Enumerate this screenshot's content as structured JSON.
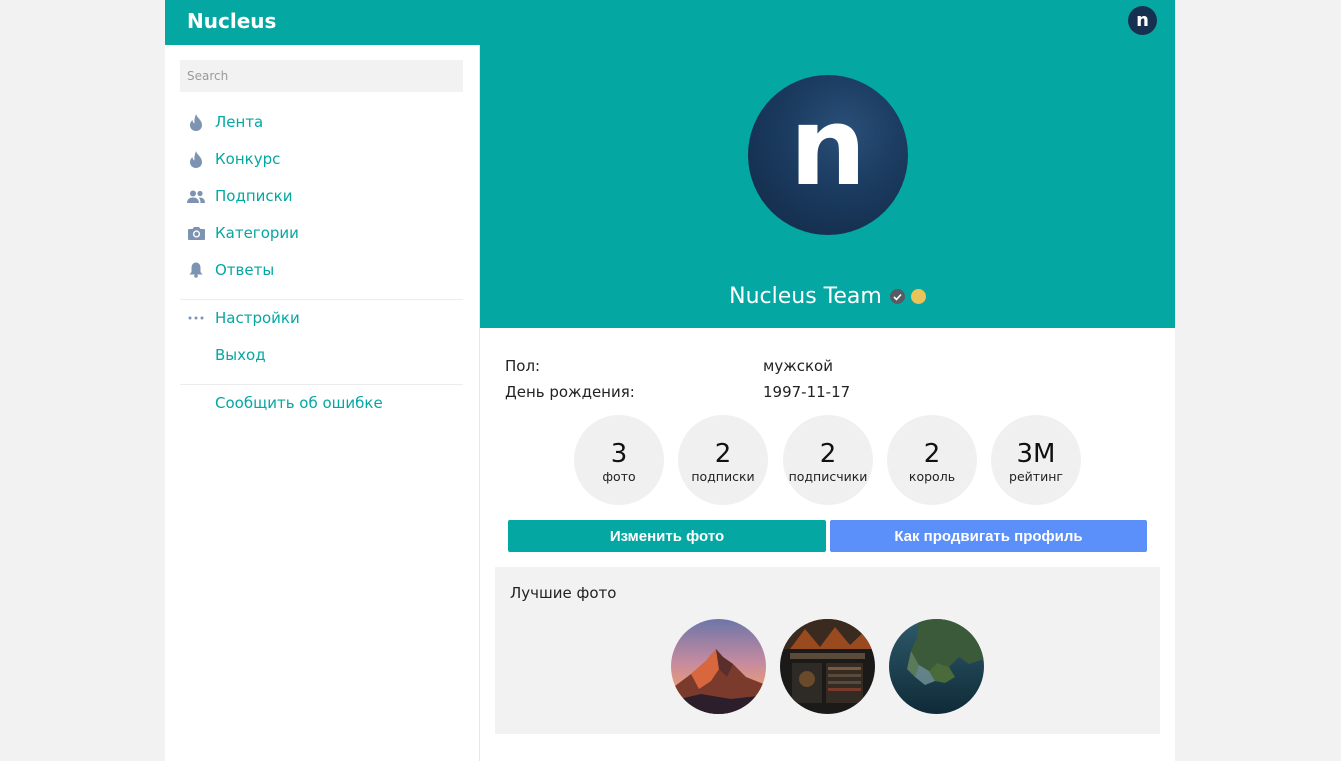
{
  "header": {
    "brand": "Nucleus",
    "avatar_letter": "n"
  },
  "sidebar": {
    "search_placeholder": "Search",
    "items": [
      {
        "label": "Лента",
        "icon": "fire-icon"
      },
      {
        "label": "Конкурс",
        "icon": "fire-icon"
      },
      {
        "label": "Подписки",
        "icon": "people-icon"
      },
      {
        "label": "Категории",
        "icon": "camera-icon"
      },
      {
        "label": "Ответы",
        "icon": "bell-icon"
      },
      {
        "label": "Настройки",
        "icon": "more-dots-icon"
      },
      {
        "label": "Выход"
      },
      {
        "label": "Сообщить об ошибке"
      }
    ]
  },
  "profile": {
    "avatar_letter": "n",
    "name": "Nucleus Team",
    "gender_label": "Пол:",
    "gender_value": "мужской",
    "birthday_label": "День рождения:",
    "birthday_value": "1997-11-17",
    "stats": [
      {
        "value": "3",
        "label": "фото"
      },
      {
        "value": "2",
        "label": "подписки"
      },
      {
        "value": "2",
        "label": "подписчики"
      },
      {
        "value": "2",
        "label": "король"
      },
      {
        "value": "3M",
        "label": "рейтинг"
      }
    ],
    "change_photo_label": "Изменить фото",
    "promote_label": "Как продвигать профиль",
    "best_photos_title": "Лучшие фото"
  },
  "colors": {
    "accent": "#05a7a3",
    "blue_button": "#5b8ff9",
    "status_dot": "#e8c45a"
  }
}
